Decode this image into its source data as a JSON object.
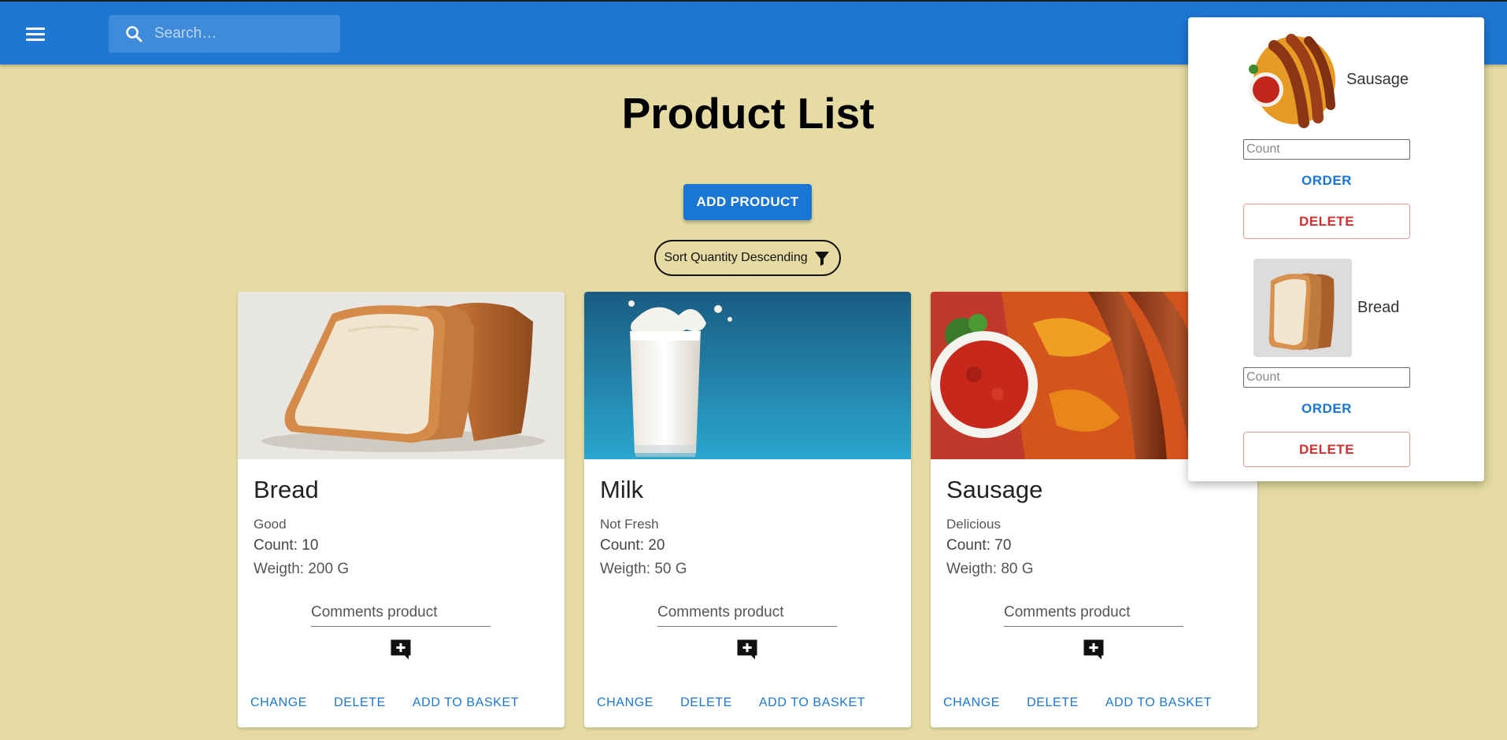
{
  "header": {
    "menu_icon": "hamburger-menu-icon",
    "search_icon": "search-icon",
    "search_placeholder": "Search…"
  },
  "page": {
    "title": "Product List",
    "add_product_label": "ADD PRODUCT",
    "sort_label": "Sort Quantity Descending",
    "sort_icon": "filter-icon"
  },
  "products": [
    {
      "name": "Bread",
      "description": "Good",
      "count": "Count: 10",
      "weight": "Weigth: 200 G",
      "comment_placeholder": "Comments product",
      "comment_icon": "add-comment-icon",
      "actions": {
        "change": "CHANGE",
        "delete": "DELETE",
        "basket": "ADD TO BASKET"
      }
    },
    {
      "name": "Milk",
      "description": "Not Fresh",
      "count": "Count: 20",
      "weight": "Weigth: 50 G",
      "comment_placeholder": "Comments product",
      "comment_icon": "add-comment-icon",
      "actions": {
        "change": "CHANGE",
        "delete": "DELETE",
        "basket": "ADD TO BASKET"
      }
    },
    {
      "name": "Sausage",
      "description": "Delicious",
      "count": "Count: 70",
      "weight": "Weigth: 80 G",
      "comment_placeholder": "Comments product",
      "comment_icon": "add-comment-icon",
      "actions": {
        "change": "CHANGE",
        "delete": "DELETE",
        "basket": "ADD TO BASKET"
      }
    }
  ],
  "basket": {
    "items": [
      {
        "name": "Sausage",
        "count_placeholder": "Count",
        "order_label": "ORDER",
        "delete_label": "DELETE"
      },
      {
        "name": "Bread",
        "count_placeholder": "Count",
        "order_label": "ORDER",
        "delete_label": "DELETE"
      }
    ]
  },
  "colors": {
    "app_bar": "#1e77d3",
    "background": "#e5dba3",
    "primary": "#1976d2",
    "danger": "#d32f2f"
  }
}
